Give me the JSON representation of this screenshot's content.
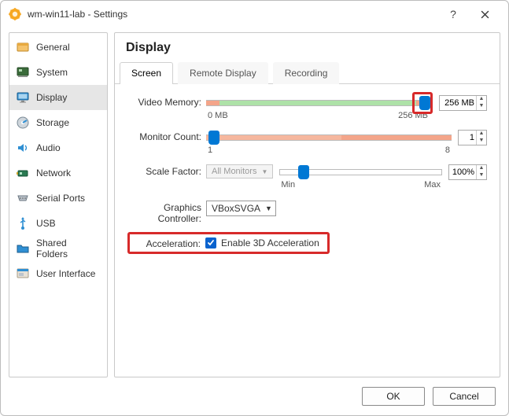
{
  "window": {
    "title": "wm-win11-lab - Settings"
  },
  "sidebar": {
    "items": [
      {
        "label": "General"
      },
      {
        "label": "System"
      },
      {
        "label": "Display"
      },
      {
        "label": "Storage"
      },
      {
        "label": "Audio"
      },
      {
        "label": "Network"
      },
      {
        "label": "Serial Ports"
      },
      {
        "label": "USB"
      },
      {
        "label": "Shared Folders"
      },
      {
        "label": "User Interface"
      }
    ],
    "selected_index": 2
  },
  "page": {
    "title": "Display",
    "tabs": [
      {
        "label": "Screen"
      },
      {
        "label": "Remote Display"
      },
      {
        "label": "Recording"
      }
    ],
    "active_tab": 0
  },
  "display": {
    "video_memory": {
      "label": "Video Memory:",
      "value": "256 MB",
      "min_label": "0 MB",
      "max_label": "256 MB",
      "pos_percent": 98
    },
    "monitor_count": {
      "label": "Monitor Count:",
      "value": "1",
      "min_label": "1",
      "max_label": "8",
      "pos_percent": 1
    },
    "scale_factor": {
      "label": "Scale Factor:",
      "selector_label": "All Monitors",
      "value": "100%",
      "min_label": "Min",
      "max_label": "Max",
      "pos_percent": 15
    },
    "graphics_controller": {
      "label": "Graphics Controller:",
      "value": "VBoxSVGA"
    },
    "acceleration": {
      "label": "Acceleration:",
      "checkbox_label": "Enable 3D Acceleration",
      "checked": true
    }
  },
  "footer": {
    "ok": "OK",
    "cancel": "Cancel"
  }
}
